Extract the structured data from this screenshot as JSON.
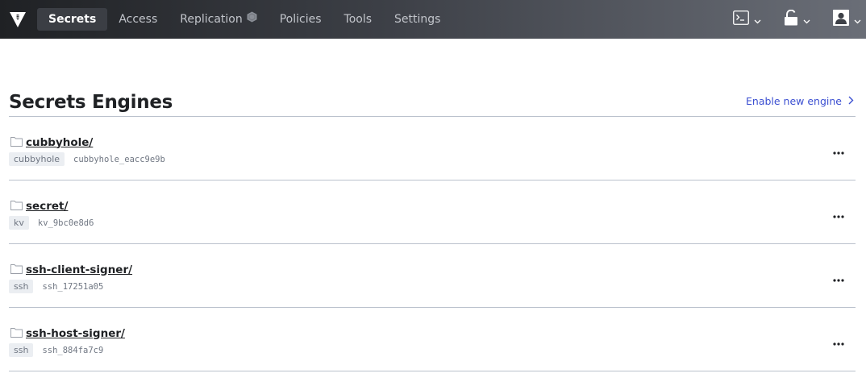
{
  "nav": {
    "items": [
      {
        "label": "Secrets",
        "active": true
      },
      {
        "label": "Access",
        "active": false
      },
      {
        "label": "Replication",
        "active": false
      },
      {
        "label": "Policies",
        "active": false
      },
      {
        "label": "Tools",
        "active": false
      },
      {
        "label": "Settings",
        "active": false
      }
    ],
    "icons": {
      "logo": "vault-logo-icon",
      "replication": "hexagon-icon",
      "console": "terminal-icon",
      "seal": "unlock-icon",
      "user": "user-icon"
    }
  },
  "page": {
    "title": "Secrets Engines",
    "enable_link": "Enable new engine"
  },
  "engines": [
    {
      "path": "cubbyhole/",
      "type": "cubbyhole",
      "accessor": "cubbyhole_eacc9e9b"
    },
    {
      "path": "secret/",
      "type": "kv",
      "accessor": "kv_9bc0e8d6"
    },
    {
      "path": "ssh-client-signer/",
      "type": "ssh",
      "accessor": "ssh_17251a05"
    },
    {
      "path": "ssh-host-signer/",
      "type": "ssh",
      "accessor": "ssh_884fa7c9"
    }
  ],
  "colors": {
    "topbar": "#1f2124",
    "link": "#3b4fd1",
    "divider": "#bac1cc",
    "tag_bg": "#ebeef2"
  }
}
